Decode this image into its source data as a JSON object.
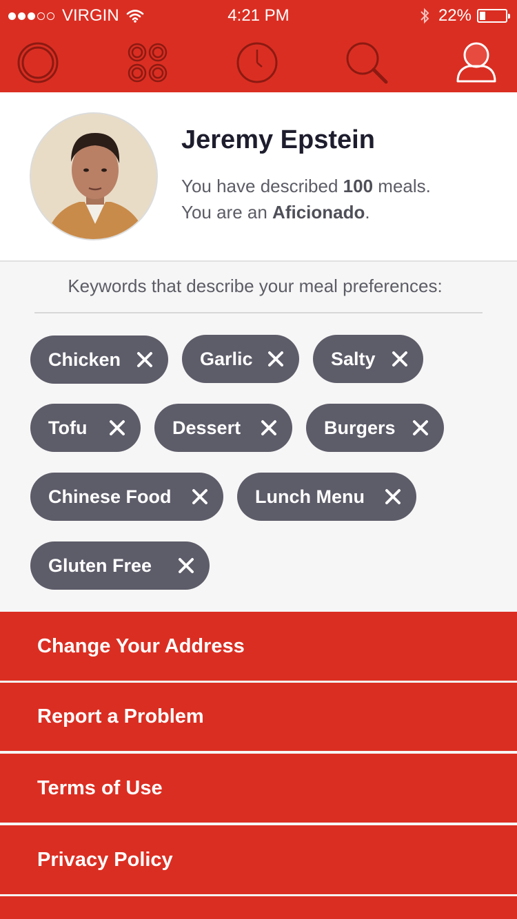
{
  "status_bar": {
    "carrier": "VIRGIN",
    "time": "4:21 PM",
    "battery": "22%",
    "battery_level": 0.22
  },
  "nav": {
    "items": [
      "home-icon",
      "grid-icon",
      "clock-icon",
      "search-icon",
      "profile-icon"
    ],
    "active": "profile-icon"
  },
  "profile": {
    "name": "Jeremy Epstein",
    "line1_prefix": "You have described ",
    "meal_count": "100",
    "line1_suffix": " meals.",
    "line2_prefix": "You are an ",
    "level": "Aficionado",
    "line2_suffix": "."
  },
  "keywords": {
    "title": "Keywords that describe your meal preferences:",
    "items": [
      "Chicken",
      "Garlic",
      "Salty",
      "Tofu",
      "Dessert",
      "Burgers",
      "Chinese Food",
      "Lunch Menu",
      "Gluten Free"
    ]
  },
  "menu": {
    "items": [
      "Change Your Address",
      "Report a Problem",
      "Terms of Use",
      "Privacy Policy"
    ]
  },
  "colors": {
    "accent": "#db2e22",
    "chip": "#5d5c69",
    "background": "#f6f6f6"
  }
}
